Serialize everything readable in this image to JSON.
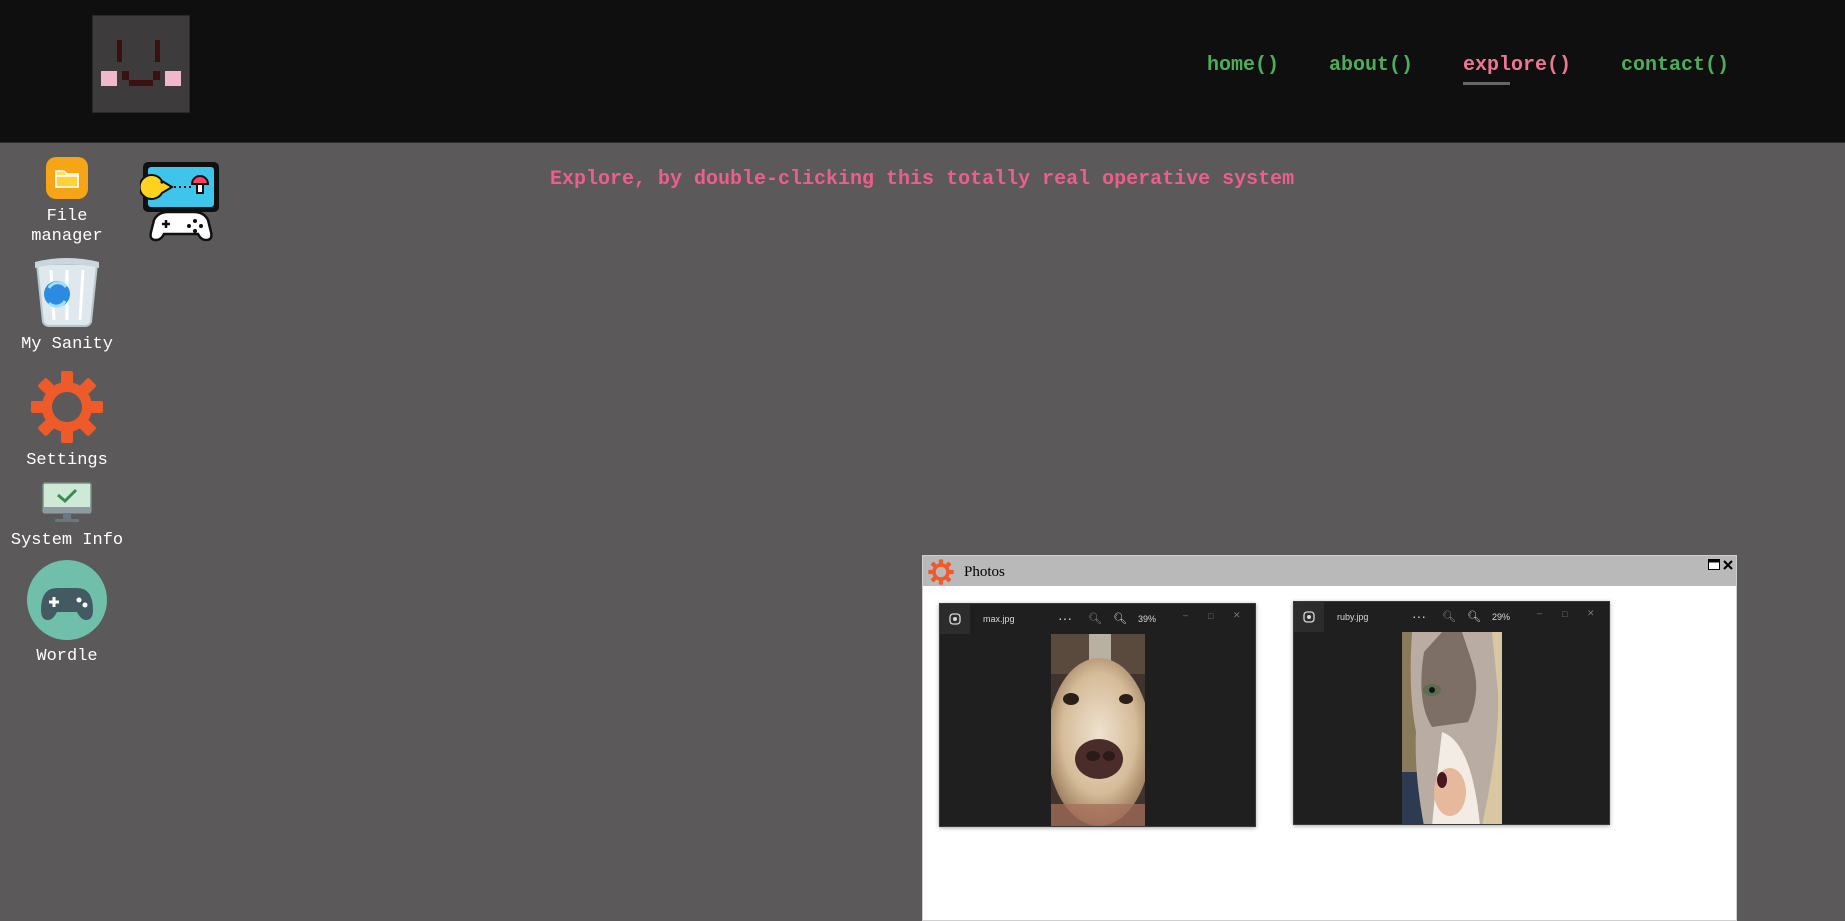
{
  "nav": {
    "items": [
      {
        "label": "home()"
      },
      {
        "label": "about()"
      },
      {
        "label": "explore()",
        "active": true
      },
      {
        "label": "contact()"
      }
    ]
  },
  "tagline": "Explore, by double-clicking this totally real operative system",
  "desktop": {
    "icons": [
      {
        "label": "File\nmanager",
        "icon": "folder-icon"
      },
      {
        "label": "",
        "icon": "arcade-games-icon"
      },
      {
        "label": "My Sanity",
        "icon": "recycle-bin-icon"
      },
      {
        "label": "Settings",
        "icon": "gear-icon"
      },
      {
        "label": "System Info",
        "icon": "monitor-check-icon"
      },
      {
        "label": "Wordle",
        "icon": "gamepad-icon"
      }
    ]
  },
  "window": {
    "title": "Photos",
    "icon": "gear-icon",
    "controls": [
      "maximize",
      "close"
    ],
    "photos": [
      {
        "filename": "max.jpg",
        "zoom": "39%",
        "subject": "dog"
      },
      {
        "filename": "ruby.jpg",
        "zoom": "29%",
        "subject": "cat"
      }
    ]
  },
  "colors": {
    "desktop_bg": "#5b595a",
    "topbar_bg": "#100f10",
    "nav_link": "#4cae59",
    "nav_active": "#ef7595",
    "tagline": "#ec5f8b",
    "accent_orange": "#ef5a2a"
  }
}
